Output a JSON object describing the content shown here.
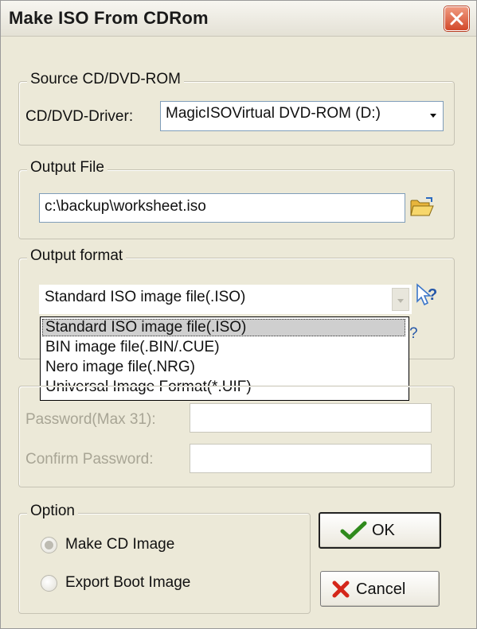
{
  "window": {
    "title": "Make ISO From CDRom"
  },
  "icons": {
    "close": "close-x-icon",
    "browse": "open-folder-icon",
    "help": "help-pointer-icon",
    "ok": "checkmark-icon",
    "cancel": "red-x-icon"
  },
  "source": {
    "legend": "Source CD/DVD-ROM",
    "driver_label": "CD/DVD-Driver:",
    "driver_value": "MagicISOVirtual DVD-ROM  (D:)"
  },
  "output_file": {
    "legend": "Output File",
    "path": "c:\\backup\\worksheet.iso"
  },
  "output_format": {
    "legend": "Output format",
    "selected": "Standard ISO image file(.ISO)",
    "options": [
      "Standard ISO image file(.ISO)",
      "BIN image file(.BIN/.CUE)",
      "Nero image file(.NRG)",
      "Universal Image Format(*.UIF)"
    ],
    "hidden_fragment": "?"
  },
  "password": {
    "password_label": "Password(Max 31):",
    "confirm_label": "Confirm Password:",
    "password_value": "",
    "confirm_value": ""
  },
  "option": {
    "legend": "Option",
    "make_cd_image": "Make CD Image",
    "export_boot_image": "Export Boot Image",
    "selected": "make_cd_image"
  },
  "buttons": {
    "ok": "OK",
    "cancel": "Cancel"
  },
  "colors": {
    "close_button": "#d2482a",
    "ok_check": "#2f8a1c",
    "cancel_x": "#d4261a",
    "disabled_text": "#a8a595"
  }
}
